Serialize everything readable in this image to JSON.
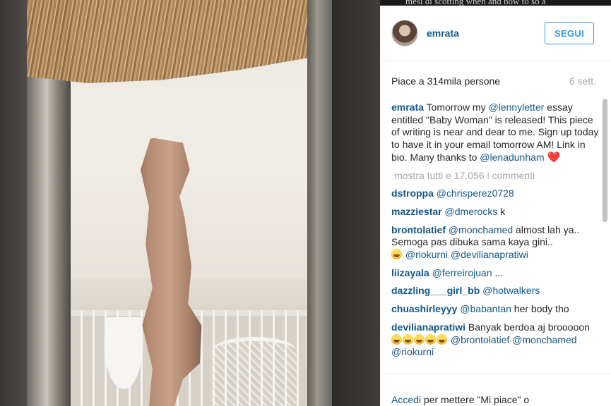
{
  "post": {
    "username": "emrata",
    "follow_label": "SEGUI",
    "likes_text": "Piace a 314mila persone",
    "time_text": "6 sett.",
    "caption": {
      "user": "emrata",
      "part1": " Tomorrow my ",
      "mention1": "@lennyletter",
      "part2": " essay entitled \"Baby Woman\" is released! This piece of writing is near and dear to me. Sign up today to have it in your email tomorrow AM! Link in bio. Many thanks to ",
      "mention2": "@lenadunham",
      "heart": "❤️"
    },
    "show_all_comments": "mostra tutti e 17.056 i commenti",
    "comments": [
      {
        "user": "dstroppa",
        "mention": "@chrisperez0728",
        "text": ""
      },
      {
        "user": "mazziestar",
        "mention": "@dmerocks",
        "text": " k"
      },
      {
        "user": "brontolatief",
        "mention": "@monchamed",
        "text": " almost lah ya.. Semoga pas dibuka sama kaya gini..",
        "mention2": "@riokurni",
        "mention3": "@devilianapratiwi"
      },
      {
        "user": "liizayala",
        "mention": "@ferreirojuan",
        "text": " ..."
      },
      {
        "user": "dazzling___girl_bb",
        "mention": "@hotwalkers",
        "text": ""
      },
      {
        "user": "chuashirleyyy",
        "mention": "@babantan",
        "text": " her body tho"
      },
      {
        "user": "devilianapratiwi",
        "text": " Banyak berdoa aj brooooon ",
        "mention": "@brontolatief",
        "mention2": "@monchamed",
        "mention3": "@riokurni"
      }
    ],
    "login": {
      "link": "Accedi",
      "text": " per mettere \"Mi piace\" o"
    },
    "more_dots": "..."
  },
  "background": {
    "text_fragment": "mesi di scotting when and how to so a"
  }
}
